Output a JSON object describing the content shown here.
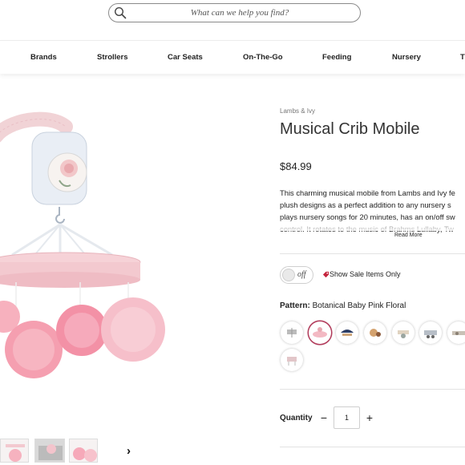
{
  "search": {
    "placeholder": "What can we help you find?"
  },
  "nav": {
    "items": [
      "Brands",
      "Strollers",
      "Car Seats",
      "On-The-Go",
      "Feeding",
      "Nursery",
      "T"
    ]
  },
  "product": {
    "brand": "Lambs & Ivy",
    "title": "Musical Crib Mobile",
    "price": "$84.99",
    "description_lines": [
      "This charming musical mobile from Lambs and Ivy fe",
      "plush designs as a perfect addition to any nursery s",
      "plays nursery songs for 20 minutes, has an on/off sw",
      "control. It rotates to the music of Brahms Lullaby, Tw"
    ],
    "read_more": "Read More"
  },
  "sale_filter": {
    "toggle_label": "off",
    "label": "Show Sale Items Only",
    "accent": "#c4243c"
  },
  "pattern": {
    "label": "Pattern:",
    "value": "Botanical Baby Pink Floral",
    "selected_index": 1,
    "swatch_count": 8
  },
  "quantity": {
    "label": "Quantity",
    "minus": "−",
    "plus": "+",
    "value": "1"
  },
  "thumbnails": {
    "next_label": "›"
  },
  "colors": {
    "pink": "#f4b8c4",
    "pink_light": "#f8d6dc",
    "selected_ring": "#b23a5a"
  }
}
